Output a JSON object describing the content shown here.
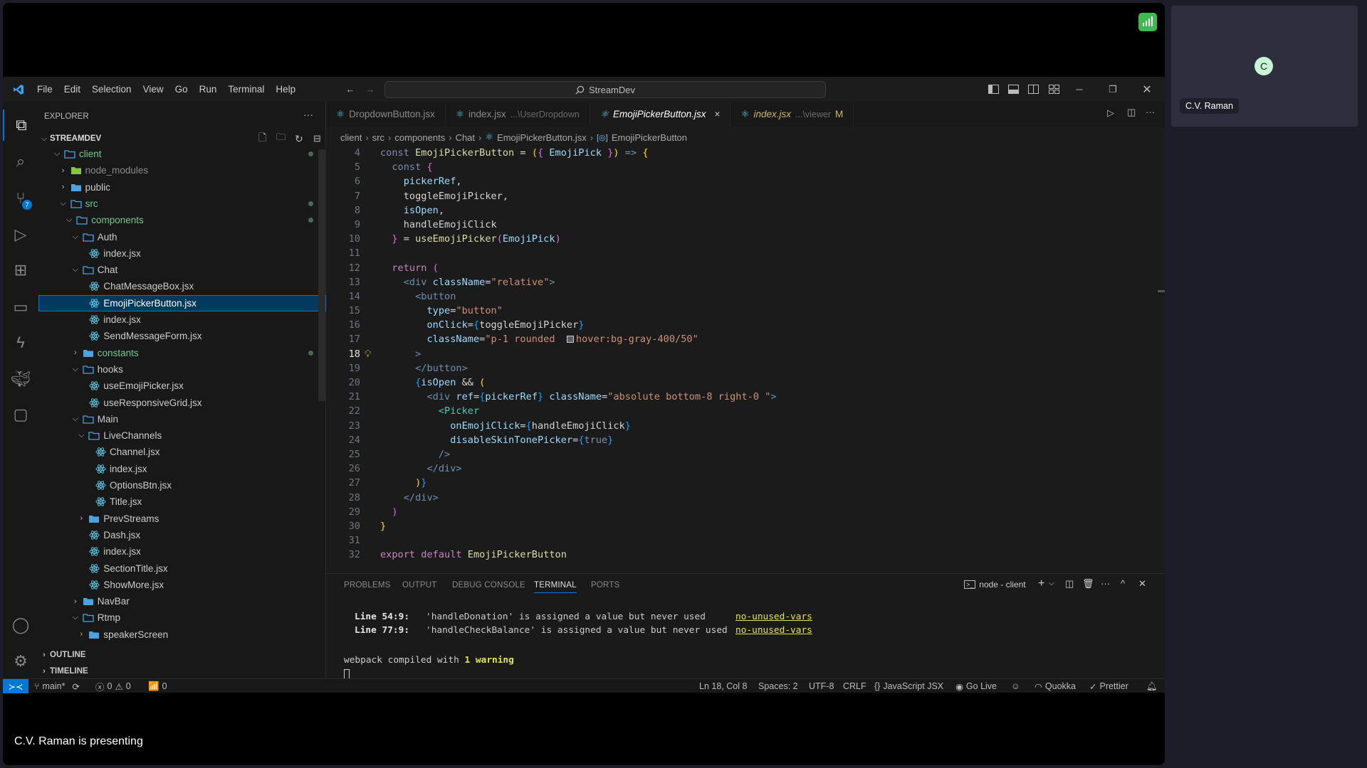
{
  "meeting": {
    "presenting_label": "C.V. Raman is presenting",
    "participant_name": "C.V. Raman",
    "participant_initial": "C",
    "signal_color": "#3fb950"
  },
  "titlebar": {
    "menu": [
      "File",
      "Edit",
      "Selection",
      "View",
      "Go",
      "Run",
      "Terminal",
      "Help"
    ],
    "command_center": "StreamDev"
  },
  "activity_bar": {
    "items": [
      "explorer-icon",
      "search-icon",
      "source-control-icon",
      "run-debug-icon",
      "extensions-icon",
      "remote-explorer-icon",
      "thunder-client-icon",
      "docker-icon",
      "chat-icon"
    ],
    "source_control_badge": "7",
    "bottom": [
      "account-icon",
      "settings-gear-icon"
    ]
  },
  "sidebar": {
    "title": "EXPLORER",
    "more": "···",
    "project": "STREAMDEV",
    "tree": [
      {
        "name": "client",
        "depth": 0,
        "kind": "folder-open",
        "color": "green",
        "dot": true
      },
      {
        "name": "node_modules",
        "depth": 1,
        "kind": "node-folder",
        "color": "dim"
      },
      {
        "name": "public",
        "depth": 1,
        "kind": "folder-closed",
        "color": "normal"
      },
      {
        "name": "src",
        "depth": 1,
        "kind": "folder-open",
        "color": "green",
        "dot": true
      },
      {
        "name": "components",
        "depth": 2,
        "kind": "folder-open",
        "color": "green",
        "dot": true
      },
      {
        "name": "Auth",
        "depth": 3,
        "kind": "folder-open",
        "color": "normal"
      },
      {
        "name": "index.jsx",
        "depth": 4,
        "kind": "file",
        "color": "normal"
      },
      {
        "name": "Chat",
        "depth": 3,
        "kind": "folder-open",
        "color": "normal"
      },
      {
        "name": "ChatMessageBox.jsx",
        "depth": 4,
        "kind": "file",
        "color": "normal"
      },
      {
        "name": "EmojiPickerButton.jsx",
        "depth": 4,
        "kind": "file",
        "color": "normal",
        "selected": true
      },
      {
        "name": "index.jsx",
        "depth": 4,
        "kind": "file",
        "color": "normal"
      },
      {
        "name": "SendMessageForm.jsx",
        "depth": 4,
        "kind": "file",
        "color": "normal"
      },
      {
        "name": "constants",
        "depth": 3,
        "kind": "folder-closed",
        "color": "green",
        "dot": true
      },
      {
        "name": "hooks",
        "depth": 3,
        "kind": "folder-open",
        "color": "normal"
      },
      {
        "name": "useEmojiPicker.jsx",
        "depth": 4,
        "kind": "file",
        "color": "normal"
      },
      {
        "name": "useResponsiveGrid.jsx",
        "depth": 4,
        "kind": "file",
        "color": "normal"
      },
      {
        "name": "Main",
        "depth": 3,
        "kind": "folder-open",
        "color": "normal"
      },
      {
        "name": "LiveChannels",
        "depth": 4,
        "kind": "folder-open",
        "color": "normal"
      },
      {
        "name": "Channel.jsx",
        "depth": 5,
        "kind": "file",
        "color": "normal"
      },
      {
        "name": "index.jsx",
        "depth": 5,
        "kind": "file",
        "color": "normal"
      },
      {
        "name": "OptionsBtn.jsx",
        "depth": 5,
        "kind": "file",
        "color": "normal"
      },
      {
        "name": "Title.jsx",
        "depth": 5,
        "kind": "file",
        "color": "normal"
      },
      {
        "name": "PrevStreams",
        "depth": 4,
        "kind": "folder-closed",
        "color": "normal"
      },
      {
        "name": "Dash.jsx",
        "depth": 4,
        "kind": "file",
        "color": "normal"
      },
      {
        "name": "index.jsx",
        "depth": 4,
        "kind": "file",
        "color": "normal"
      },
      {
        "name": "SectionTitle.jsx",
        "depth": 4,
        "kind": "file",
        "color": "normal"
      },
      {
        "name": "ShowMore.jsx",
        "depth": 4,
        "kind": "file",
        "color": "normal"
      },
      {
        "name": "NavBar",
        "depth": 3,
        "kind": "folder-closed",
        "color": "normal"
      },
      {
        "name": "Rtmp",
        "depth": 3,
        "kind": "folder-open",
        "color": "normal"
      },
      {
        "name": "speakerScreen",
        "depth": 4,
        "kind": "folder-closed",
        "color": "normal"
      }
    ],
    "sections": [
      "OUTLINE",
      "TIMELINE"
    ]
  },
  "editor": {
    "tabs": [
      {
        "label": "DropdownButton.jsx",
        "desc": ""
      },
      {
        "label": "index.jsx",
        "desc": "...\\UserDropdown"
      },
      {
        "label": "EmojiPickerButton.jsx",
        "desc": "",
        "active": true,
        "close": "×"
      },
      {
        "label": "index.jsx",
        "desc": "...\\viewer",
        "badge": "M",
        "modified": true
      }
    ],
    "breadcrumb": [
      "client",
      "src",
      "components",
      "Chat",
      "EmojiPickerButton.jsx",
      "EmojiPickerButton"
    ],
    "current_line": 18,
    "lines": [
      {
        "n": "4",
        "t": [
          [
            "const ",
            "kw"
          ],
          [
            "EmojiPickerButton",
            "fn"
          ],
          [
            " = ",
            "pn"
          ],
          [
            "(",
            "b1"
          ],
          [
            "{",
            "b2"
          ],
          [
            " EmojiPick ",
            "vr"
          ],
          [
            "}",
            "b2"
          ],
          [
            ")",
            "b1"
          ],
          [
            " => ",
            "kw"
          ],
          [
            "{",
            "b1"
          ]
        ]
      },
      {
        "n": "5",
        "t": [
          [
            "  const ",
            "kw"
          ],
          [
            "{",
            "b2"
          ]
        ]
      },
      {
        "n": "6",
        "t": [
          [
            "    pickerRef",
            "vr"
          ],
          [
            ",",
            "pn"
          ]
        ]
      },
      {
        "n": "7",
        "t": [
          [
            "    toggleEmojiPicker",
            "pl"
          ],
          [
            ",",
            "pn"
          ]
        ]
      },
      {
        "n": "8",
        "t": [
          [
            "    isOpen",
            "vr"
          ],
          [
            ",",
            "pn"
          ]
        ]
      },
      {
        "n": "9",
        "t": [
          [
            "    handleEmojiClick",
            "pl"
          ]
        ]
      },
      {
        "n": "10",
        "t": [
          [
            "  }",
            "b2"
          ],
          [
            " = ",
            "pn"
          ],
          [
            "useEmojiPicker",
            "fn"
          ],
          [
            "(",
            "b2"
          ],
          [
            "EmojiPick",
            "vr"
          ],
          [
            ")",
            "b2"
          ]
        ]
      },
      {
        "n": "11",
        "t": []
      },
      {
        "n": "12",
        "t": [
          [
            "  return ",
            "ctl"
          ],
          [
            "(",
            "b2"
          ]
        ]
      },
      {
        "n": "13",
        "t": [
          [
            "    <div ",
            "tg"
          ],
          [
            "className",
            "at"
          ],
          [
            "=",
            "pn"
          ],
          [
            "\"relative\"",
            "st"
          ],
          [
            ">",
            "tg"
          ]
        ]
      },
      {
        "n": "14",
        "t": [
          [
            "      <button",
            "tg"
          ]
        ]
      },
      {
        "n": "15",
        "t": [
          [
            "        type",
            "at"
          ],
          [
            "=",
            "pn"
          ],
          [
            "\"button\"",
            "st"
          ]
        ]
      },
      {
        "n": "16",
        "t": [
          [
            "        onClick",
            "at"
          ],
          [
            "=",
            "pn"
          ],
          [
            "{",
            "b3"
          ],
          [
            "toggleEmojiPicker",
            "pl"
          ],
          [
            "}",
            "b3"
          ]
        ]
      },
      {
        "n": "17",
        "t": [
          [
            "        className",
            "at"
          ],
          [
            "=",
            "pn"
          ],
          [
            "\"p-1 rounded  ",
            "st"
          ],
          [
            "",
            "sw"
          ],
          [
            "hover:bg-gray-400/50\"",
            "st"
          ]
        ]
      },
      {
        "n": "18",
        "t": [
          [
            "      >",
            "tg"
          ]
        ]
      },
      {
        "n": "19",
        "t": [
          [
            "      </button>",
            "tg"
          ]
        ]
      },
      {
        "n": "20",
        "t": [
          [
            "      {",
            "b3"
          ],
          [
            "isOpen",
            "vr"
          ],
          [
            " && ",
            "pn"
          ],
          [
            "(",
            "b1"
          ]
        ]
      },
      {
        "n": "21",
        "t": [
          [
            "        <div ",
            "tg"
          ],
          [
            "ref",
            "at"
          ],
          [
            "=",
            "pn"
          ],
          [
            "{",
            "b3"
          ],
          [
            "pickerRef",
            "vr"
          ],
          [
            "}",
            "b3"
          ],
          [
            " className",
            "at"
          ],
          [
            "=",
            "pn"
          ],
          [
            "\"absolute bottom-8 right-0 \"",
            "st"
          ],
          [
            ">",
            "tg"
          ]
        ]
      },
      {
        "n": "22",
        "t": [
          [
            "          <Picker",
            "cm"
          ]
        ]
      },
      {
        "n": "23",
        "t": [
          [
            "            onEmojiClick",
            "at"
          ],
          [
            "=",
            "pn"
          ],
          [
            "{",
            "b3"
          ],
          [
            "handleEmojiClick",
            "pl"
          ],
          [
            "}",
            "b3"
          ]
        ]
      },
      {
        "n": "24",
        "t": [
          [
            "            disableSkinTonePicker",
            "at"
          ],
          [
            "=",
            "pn"
          ],
          [
            "{",
            "b3"
          ],
          [
            "true",
            "kw"
          ],
          [
            "}",
            "b3"
          ]
        ]
      },
      {
        "n": "25",
        "t": [
          [
            "          />",
            "tg"
          ]
        ]
      },
      {
        "n": "26",
        "t": [
          [
            "        </div>",
            "tg"
          ]
        ]
      },
      {
        "n": "27",
        "t": [
          [
            "      )",
            "b1"
          ],
          [
            "}",
            "b3"
          ]
        ]
      },
      {
        "n": "28",
        "t": [
          [
            "    </div>",
            "tg"
          ]
        ]
      },
      {
        "n": "29",
        "t": [
          [
            "  )",
            "b2"
          ]
        ]
      },
      {
        "n": "30",
        "t": [
          [
            "}",
            "b1"
          ]
        ]
      },
      {
        "n": "31",
        "t": []
      },
      {
        "n": "32",
        "t": [
          [
            "export default ",
            "ctl"
          ],
          [
            "EmojiPickerButton",
            "fn"
          ]
        ]
      }
    ]
  },
  "panel": {
    "tabs": [
      "PROBLEMS",
      "OUTPUT",
      "DEBUG CONSOLE",
      "TERMINAL",
      "PORTS"
    ],
    "active_tab": "TERMINAL",
    "terminal_name": "node - client",
    "warnings": [
      {
        "loc": "Line 54:9:",
        "msg": "'handleDonation' is assigned a value but never used    ",
        "rule": "no-unused-vars"
      },
      {
        "loc": "Line 77:9:",
        "msg": "'handleCheckBalance' is assigned a value but never used",
        "rule": "no-unused-vars"
      }
    ],
    "compiled_prefix": "webpack compiled with ",
    "compiled_warning": "1 warning"
  },
  "status": {
    "branch": "main*",
    "errors": "0",
    "warnings": "0",
    "ports": "0",
    "cursor": "Ln 18, Col 8",
    "spaces": "Spaces: 2",
    "encoding": "UTF-8",
    "eol": "CRLF",
    "language": "JavaScript JSX",
    "golive": "Go Live",
    "quokka": "Quokka",
    "prettier": "Prettier"
  }
}
